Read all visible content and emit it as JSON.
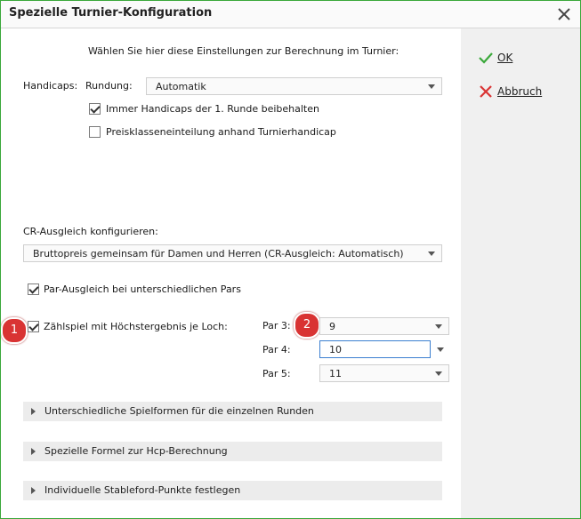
{
  "window": {
    "title": "Spezielle Turnier-Konfiguration"
  },
  "intro": "Wählen Sie hier diese Einstellungen zur Berechnung im Turnier:",
  "handicaps": {
    "label": "Handicaps:",
    "rundung_label": "Rundung:",
    "rundung_value": "Automatik",
    "keep_first_round": {
      "label": "Immer Handicaps der 1. Runde beibehalten",
      "checked": true
    },
    "price_classes": {
      "label": "Preisklasseneinteilung anhand Turnierhandicap",
      "checked": false
    }
  },
  "cr": {
    "label": "CR-Ausgleich konfigurieren:",
    "value": "Bruttopreis gemeinsam für Damen und Herren (CR-Ausgleich: Automatisch)"
  },
  "par_ausgleich": {
    "label": "Par-Ausgleich bei unterschiedlichen Pars",
    "checked": true
  },
  "zaehlspiel": {
    "label": "Zählspiel mit Höchstergebnis je Loch:",
    "checked": true,
    "par3": {
      "label": "Par 3:",
      "value": "9"
    },
    "par4": {
      "label": "Par 4:",
      "value": "10"
    },
    "par5": {
      "label": "Par 5:",
      "value": "11"
    }
  },
  "markers": {
    "one": "1",
    "two": "2"
  },
  "sections": [
    {
      "label": "Unterschiedliche Spielformen für die einzelnen Runden"
    },
    {
      "label": "Spezielle Formel zur Hcp-Berechnung"
    },
    {
      "label": "Individuelle Stableford-Punkte festlegen"
    }
  ],
  "buttons": {
    "ok": "OK",
    "cancel": "Abbruch"
  },
  "colors": {
    "border": "#3aa83a",
    "ok_icon": "#3aa83a",
    "cancel_icon": "#d93333",
    "badge": "#d93333",
    "focus": "#3c7fd0"
  }
}
